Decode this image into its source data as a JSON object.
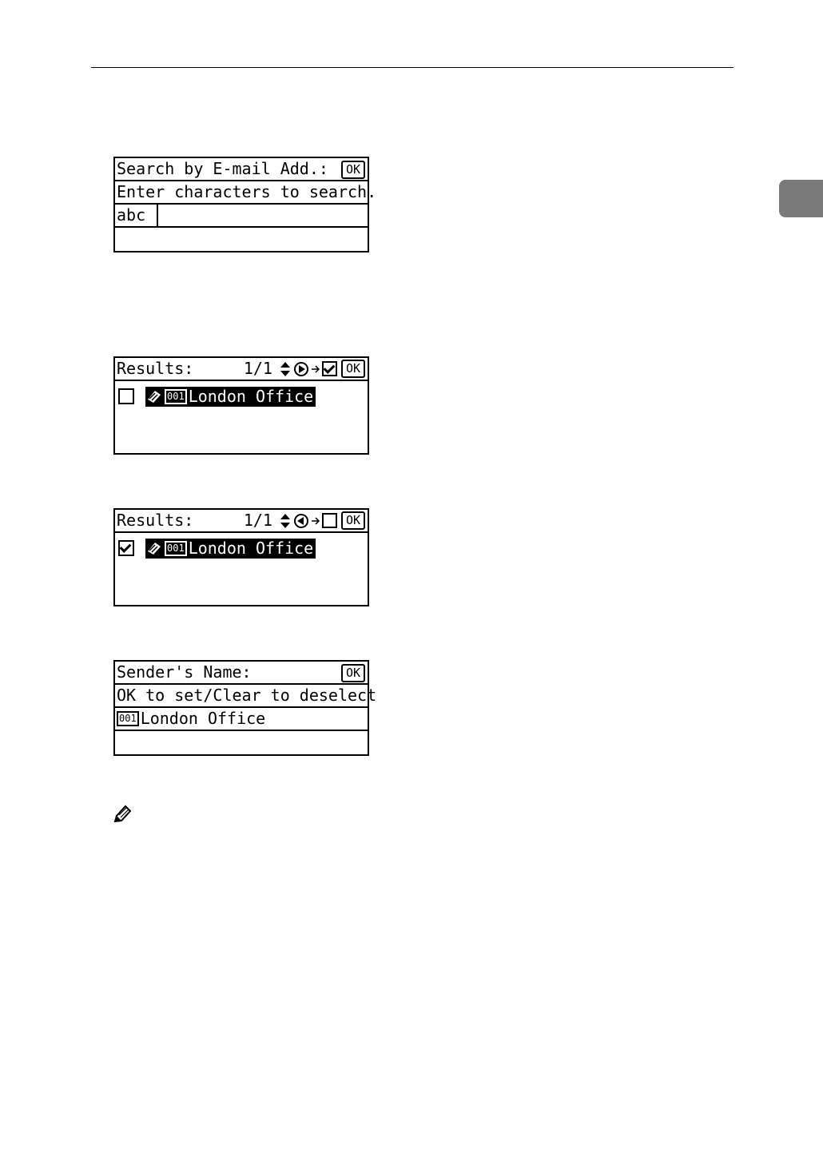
{
  "screen1": {
    "title": "Search by E-mail Add.:",
    "ok_label": "OK",
    "instruction": "Enter characters to search.",
    "input_mode": "abc"
  },
  "screen2": {
    "title": "Results:",
    "page": "1/1",
    "ok_label": "OK",
    "checkbox_checked": false,
    "entry_number": "001",
    "entry_name": "London Office"
  },
  "screen3": {
    "title": "Results:",
    "page": "1/1",
    "ok_label": "OK",
    "checkbox_checked": true,
    "entry_number": "001",
    "entry_name": "London Office"
  },
  "screen4": {
    "title": "Sender's Name:",
    "ok_label": "OK",
    "instruction": "OK to set/Clear to deselect",
    "entry_number": "001",
    "entry_name": "London Office"
  },
  "icons": [
    "pencil-note-icon",
    "up-down-arrow-icon",
    "right-circle-icon",
    "left-circle-icon",
    "checkbox-icon"
  ]
}
